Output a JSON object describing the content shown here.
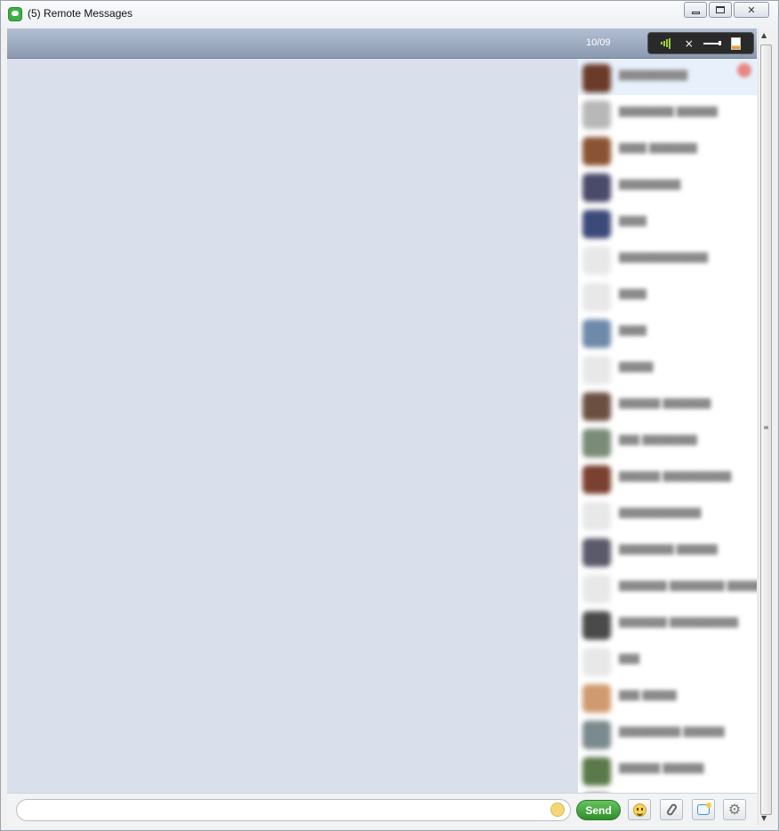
{
  "window": {
    "title": "(5) Remote Messages"
  },
  "header": {
    "date_label": "10/09",
    "tools": [
      {
        "name": "signal-strength-icon"
      },
      {
        "name": "close-icon",
        "glyph": "×"
      },
      {
        "name": "filter-icon"
      },
      {
        "name": "sidebar-toggle-icon"
      }
    ]
  },
  "contacts": {
    "items": [
      {
        "name": "██████████",
        "avatar_color": "#6b3b2a",
        "selected": true,
        "badge": true
      },
      {
        "name": "████████ ██████",
        "avatar_color": "#b8b8b8"
      },
      {
        "name": "████ ███████",
        "avatar_color": "#8a5434"
      },
      {
        "name": "█████████",
        "avatar_color": "#4a4a6a"
      },
      {
        "name": "████",
        "avatar_color": "#3c4a7a"
      },
      {
        "name": "█████████████",
        "avatar_color": "#e8e8e8"
      },
      {
        "name": "████",
        "avatar_color": "#e8e8e8"
      },
      {
        "name": "████",
        "avatar_color": "#6e8aaa"
      },
      {
        "name": "█████",
        "avatar_color": "#e8e8e8"
      },
      {
        "name": "██████ ███████",
        "avatar_color": "#6b5042"
      },
      {
        "name": "███ ████████",
        "avatar_color": "#7a8c78"
      },
      {
        "name": "██████ ██████████",
        "avatar_color": "#7a4030"
      },
      {
        "name": "████████████",
        "avatar_color": "#e8e8e8"
      },
      {
        "name": "████████ ██████",
        "avatar_color": "#5a5a6a"
      },
      {
        "name": "███████ ████████ ███████",
        "avatar_color": "#e8e8e8"
      },
      {
        "name": "███████ ██████████",
        "avatar_color": "#4a4a4a"
      },
      {
        "name": "███",
        "avatar_color": "#e8e8e8"
      },
      {
        "name": "███ █████",
        "avatar_color": "#d09a70"
      },
      {
        "name": "█████████ ██████",
        "avatar_color": "#7a8a8e"
      },
      {
        "name": "██████ ██████",
        "avatar_color": "#5a7a4a"
      },
      {
        "name": "",
        "avatar_color": "#4a5a4a"
      }
    ]
  },
  "composer": {
    "input_value": "",
    "input_placeholder": "",
    "send_label": "Send",
    "buttons": [
      {
        "name": "emoji-button"
      },
      {
        "name": "attach-button"
      },
      {
        "name": "sms-bubble-button"
      },
      {
        "name": "settings-button"
      }
    ]
  },
  "colors": {
    "header_blue": "#8b9ab1",
    "conversation_bg": "#dae0eb",
    "send_green": "#3f9e38"
  }
}
